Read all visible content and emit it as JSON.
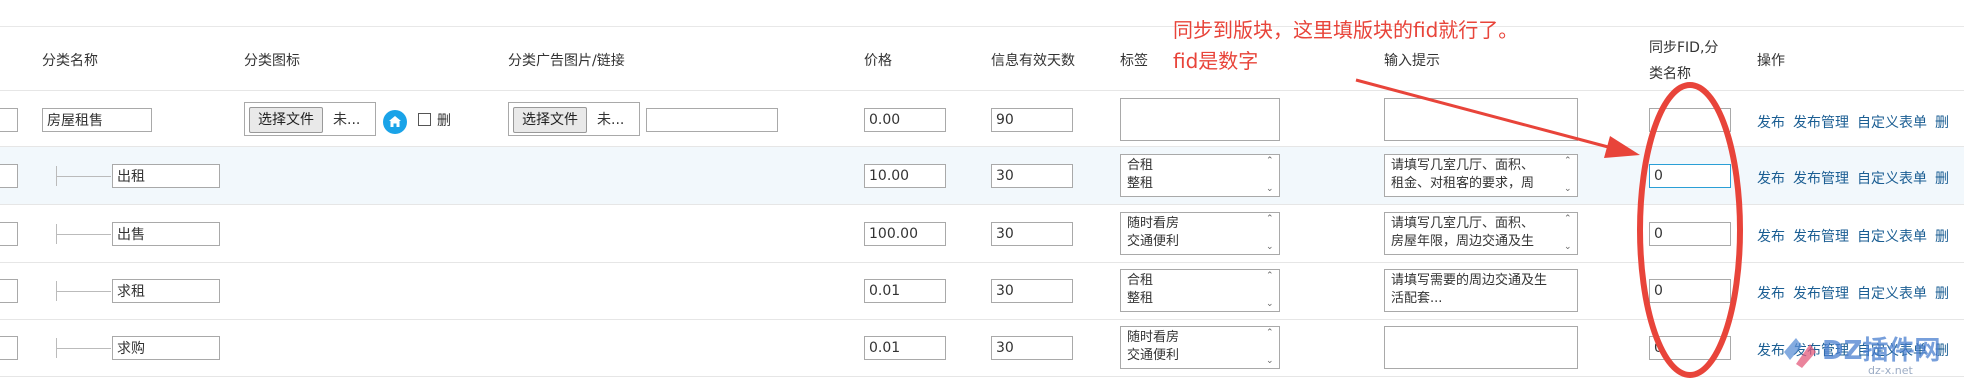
{
  "headers": {
    "name": "分类名称",
    "icon": "分类图标",
    "ad": "分类广告图片/链接",
    "price": "价格",
    "days": "信息有效天数",
    "tags": "标签",
    "hint": "输入提示",
    "sync_line1": "同步FID,分",
    "sync_line2": "类名称",
    "ops": "操作"
  },
  "file_button": "选择文件",
  "file_none": "未...",
  "delete_label": "删",
  "ops_links": {
    "publish": "发布",
    "manage": "发布管理",
    "custom_form": "自定义表单",
    "delete": "删"
  },
  "rows": [
    {
      "name": "房屋租售",
      "price": "0.00",
      "days": "90",
      "tags": [
        "",
        ""
      ],
      "hint": [
        "",
        ""
      ],
      "fid": ""
    },
    {
      "name": "出租",
      "price": "10.00",
      "days": "30",
      "tags": [
        "合租",
        "整租"
      ],
      "hint": [
        "请填写几室几厅、面积、",
        "租金、对租客的要求，周"
      ],
      "fid": "0"
    },
    {
      "name": "出售",
      "price": "100.00",
      "days": "30",
      "tags": [
        "随时看房",
        "交通便利"
      ],
      "hint": [
        "请填写几室几厅、面积、",
        "房屋年限，周边交通及生"
      ],
      "fid": "0"
    },
    {
      "name": "求租",
      "price": "0.01",
      "days": "30",
      "tags": [
        "合租",
        "整租"
      ],
      "hint": [
        "请填写需要的周边交通及生",
        "活配套..."
      ],
      "fid": "0"
    },
    {
      "name": "求购",
      "price": "0.01",
      "days": "30",
      "tags": [
        "随时看房",
        "交通便利"
      ],
      "hint": [
        "",
        ""
      ],
      "fid": "0"
    }
  ],
  "annotation": {
    "line1": "同步到版块，这里填版块的fid就行了。",
    "line2": "fid是数字",
    "color": "#e8443a"
  },
  "watermark": {
    "text": "DZ插件网",
    "sub": "dz-x.net"
  }
}
